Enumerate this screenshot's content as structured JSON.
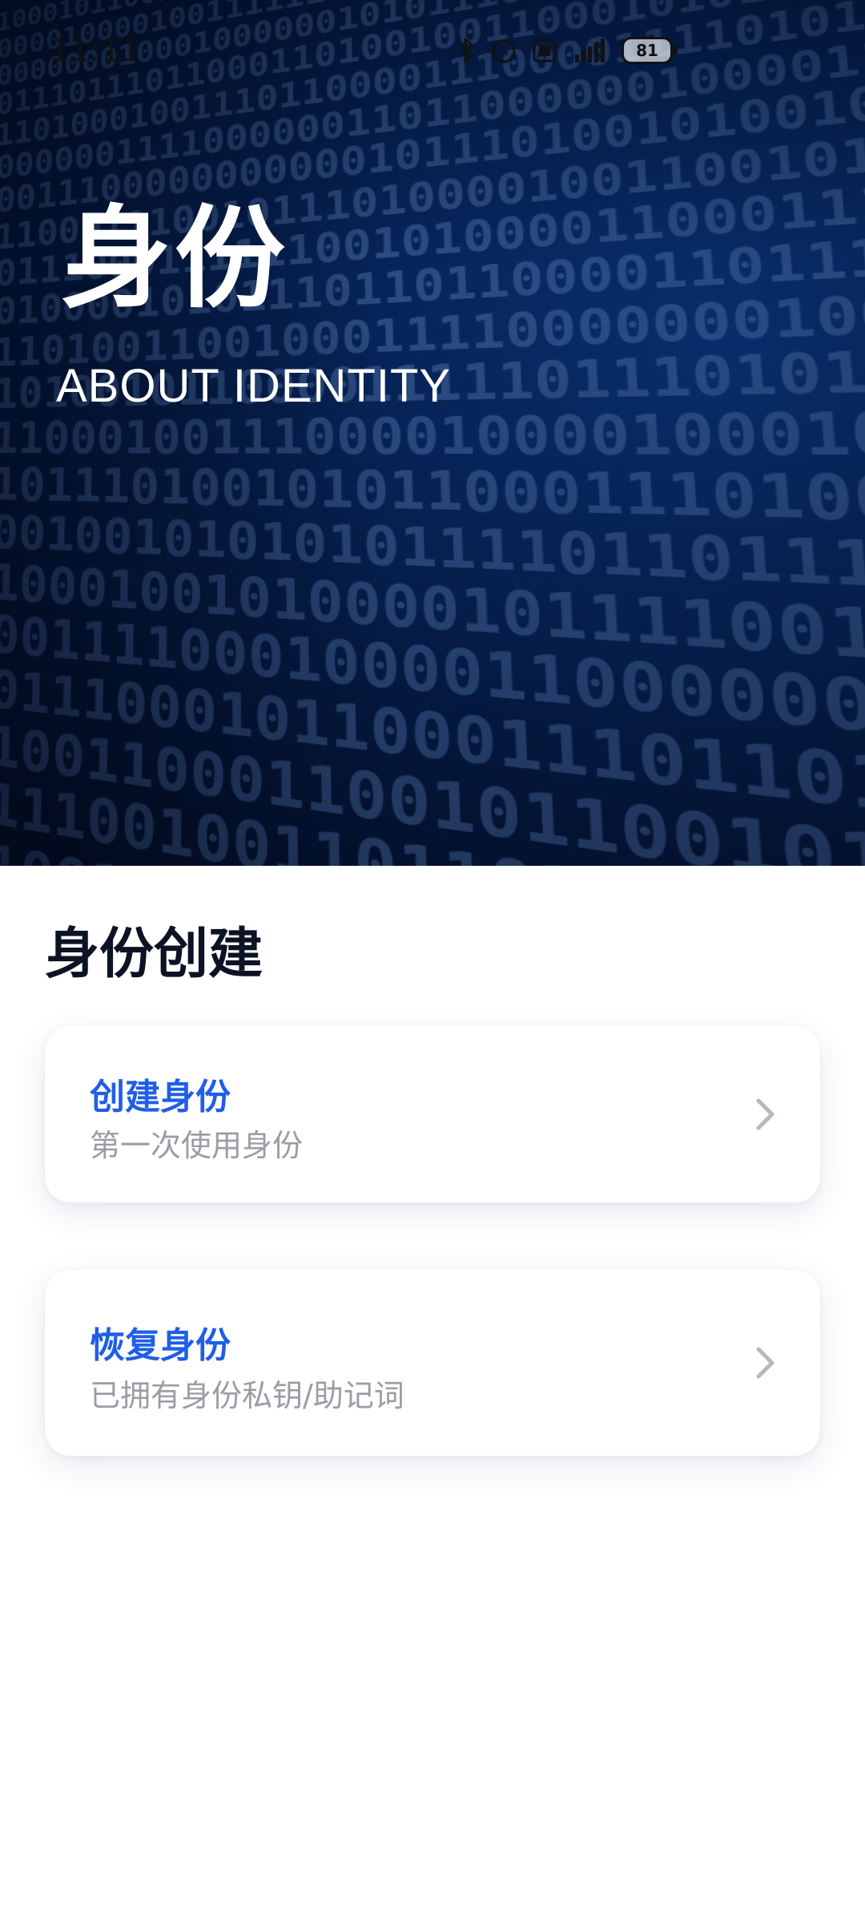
{
  "status_bar": {
    "time": "11:11",
    "icons": [
      "bluetooth-icon",
      "alarm-icon",
      "nfc-icon",
      "signal-icon",
      "battery-icon"
    ],
    "battery_level": "81"
  },
  "hero": {
    "title": "身份",
    "subtitle": "ABOUT IDENTITY"
  },
  "section": {
    "title": "身份创建"
  },
  "cards": [
    {
      "title": "创建身份",
      "description": "第一次使用身份",
      "icon": "chevron-right-icon"
    },
    {
      "title": "恢复身份",
      "description": "已拥有身份私钥/助记词",
      "icon": "chevron-right-icon"
    }
  ],
  "colors": {
    "accent": "#1f5ee6",
    "hero_dark": "#05193f",
    "title_text": "#0b1324",
    "secondary_text": "#9a9da5"
  }
}
